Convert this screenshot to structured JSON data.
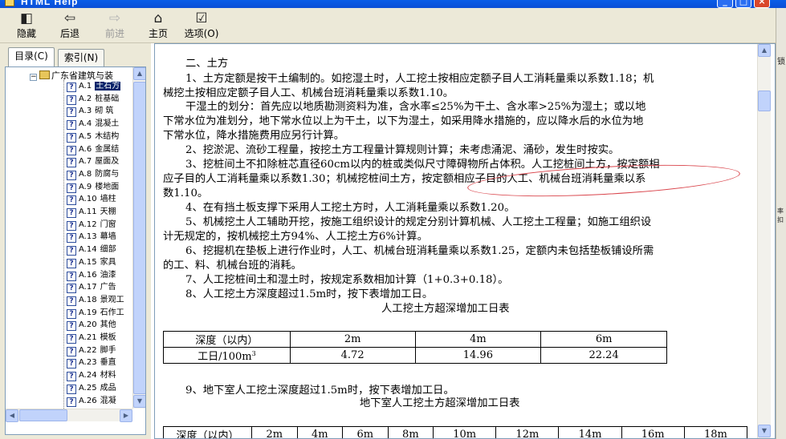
{
  "window": {
    "title": "HTML Help"
  },
  "toolbar": {
    "hide_label": "隐藏",
    "back_label": "后退",
    "forward_label": "前进",
    "home_label": "主页",
    "options_label": "选项(O)"
  },
  "tabs": {
    "contents": "目录(C)",
    "index": "索引(N)"
  },
  "tree": {
    "root": "广东省建筑与装",
    "items": [
      {
        "code": "A.1",
        "label": "土石方"
      },
      {
        "code": "A.2",
        "label": "桩基础"
      },
      {
        "code": "A.3",
        "label": "砌 筑"
      },
      {
        "code": "A.4",
        "label": "混凝土"
      },
      {
        "code": "A.5",
        "label": "木结构"
      },
      {
        "code": "A.6",
        "label": "金属结"
      },
      {
        "code": "A.7",
        "label": "屋面及"
      },
      {
        "code": "A.8",
        "label": "防腐与"
      },
      {
        "code": "A.9",
        "label": "楼地面"
      },
      {
        "code": "A.10",
        "label": "墙柱"
      },
      {
        "code": "A.11",
        "label": "天棚"
      },
      {
        "code": "A.12",
        "label": "门窗"
      },
      {
        "code": "A.13",
        "label": "幕墙"
      },
      {
        "code": "A.14",
        "label": "细部"
      },
      {
        "code": "A.15",
        "label": "家具"
      },
      {
        "code": "A.16",
        "label": "油漆"
      },
      {
        "code": "A.17",
        "label": "广告"
      },
      {
        "code": "A.18",
        "label": "景观工"
      },
      {
        "code": "A.19",
        "label": "石作工"
      },
      {
        "code": "A.20",
        "label": "其他"
      },
      {
        "code": "A.21",
        "label": "模板"
      },
      {
        "code": "A.22",
        "label": "脚手"
      },
      {
        "code": "A.23",
        "label": "垂直"
      },
      {
        "code": "A.24",
        "label": "材料"
      },
      {
        "code": "A.25",
        "label": "成品"
      },
      {
        "code": "A.26",
        "label": "混凝"
      }
    ]
  },
  "content": {
    "heading": "二、土方",
    "lines": [
      "1、土方定额是按干土编制的。如挖湿土时，人工挖土按相应定额子目人工消耗量乘以系数1.18；机",
      "械挖土按相应定额子目人工、机械台班消耗量乘以系数1.10。",
      "干湿土的划分：首先应以地质勘测资料为准，含水率≤25%为干土、含水率>25%为湿土；或以地",
      "下常水位为准划分，地下常水位以上为干土，以下为湿土，如采用降水措施的，应以降水后的水位为地",
      "下常水位，降水措施费用应另行计算。",
      "2、挖淤泥、流砂工程量，按挖土方工程量计算规则计算；未考虑涌泥、涌砂，发生时按实。",
      "3、挖桩间土不扣除桩芯直径60cm以内的桩或类似尺寸障碍物所占体积。人工挖桩间土方，按定额相",
      "应子目的人工消耗量乘以系数1.30；机械挖桩间土方，按定额相应子目的人工、机械台班消耗量乘以系",
      "数1.10。",
      "4、在有挡土板支撑下采用人工挖土方时，人工消耗量乘以系数1.20。",
      "5、机械挖土人工辅助开挖，按施工组织设计的规定分别计算机械、人工挖土工程量；如施工组织设",
      "计无规定的，按机械挖土方94%、人工挖土方6%计算。",
      "6、挖掘机在垫板上进行作业时，人工、机械台班消耗量乘以系数1.25，定额内未包括垫板铺设所需",
      "的工、料、机械台班的消耗。",
      "7、人工挖桩间土和湿土时，按规定系数相加计算（1+0.3+0.18）。",
      "8、人工挖土方深度超过1.5m时，按下表增加工日。"
    ],
    "table1_title": "人工挖土方超深增加工日表",
    "table1": {
      "header_label": "深度（以内）",
      "headers": [
        "2m",
        "4m",
        "6m"
      ],
      "row_label": "工日/100m",
      "row_label_sup": "3",
      "values": [
        "4.72",
        "14.96",
        "22.24"
      ]
    },
    "line9": "9、地下室人工挖土深度超过1.5m时，按下表增加工日。",
    "table2_title": "地下室人工挖土方超深增加工日表",
    "table2": {
      "header_label": "深度（以内）",
      "headers": [
        "2m",
        "4m",
        "6m",
        "8m",
        "10m",
        "12m",
        "14m",
        "16m",
        "18m"
      ]
    }
  },
  "right_strip": {
    "glyphs": [
      "锁",
      "率扣"
    ]
  },
  "colors": {
    "titlebar": "#0b57e0",
    "toolbar_bg": "#ece9d8",
    "selection": "#0a246a",
    "annotation_oval": "#d9434a"
  }
}
